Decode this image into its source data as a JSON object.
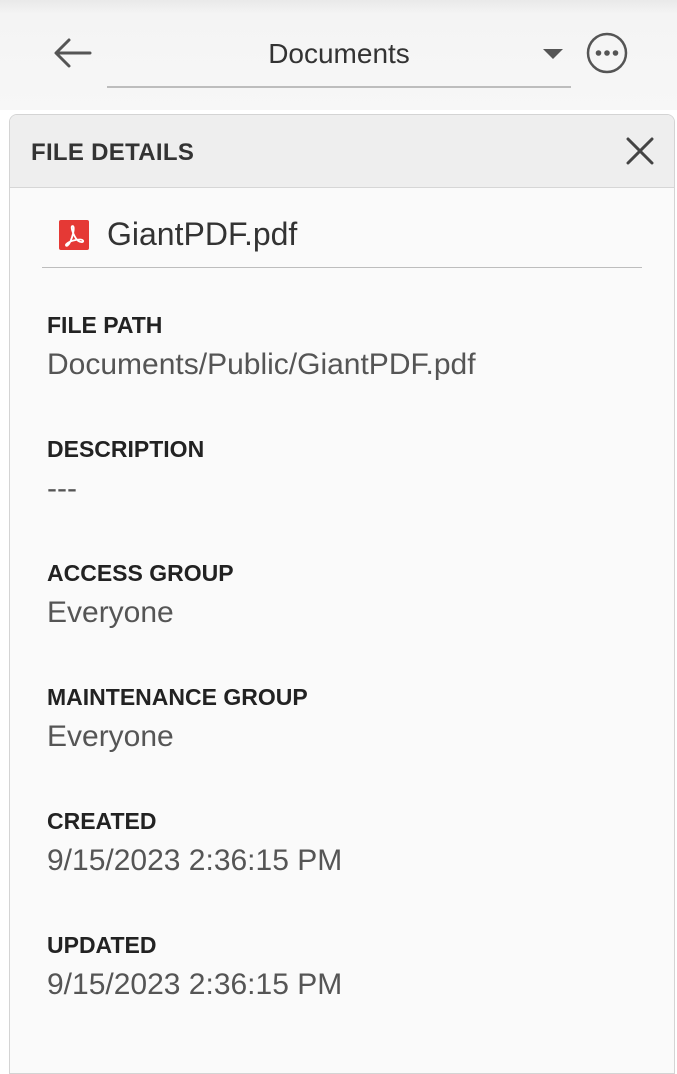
{
  "header": {
    "folder_dropdown": "Documents",
    "icons": {
      "back": "arrow-left-icon",
      "caret": "caret-down-icon",
      "more": "more-options-icon"
    }
  },
  "panel": {
    "title": "FILE DETAILS",
    "close_icon": "close-icon",
    "file": {
      "icon": "pdf-file-icon",
      "icon_color": "#e53935",
      "name": "GiantPDF.pdf"
    },
    "fields": [
      {
        "label": "FILE PATH",
        "value": "Documents/Public/GiantPDF.pdf"
      },
      {
        "label": "DESCRIPTION",
        "value": "---"
      },
      {
        "label": "ACCESS GROUP",
        "value": "Everyone"
      },
      {
        "label": "MAINTENANCE GROUP",
        "value": "Everyone"
      },
      {
        "label": "CREATED",
        "value": "9/15/2023 2:36:15 PM"
      },
      {
        "label": "UPDATED",
        "value": "9/15/2023 2:36:15 PM"
      }
    ]
  }
}
